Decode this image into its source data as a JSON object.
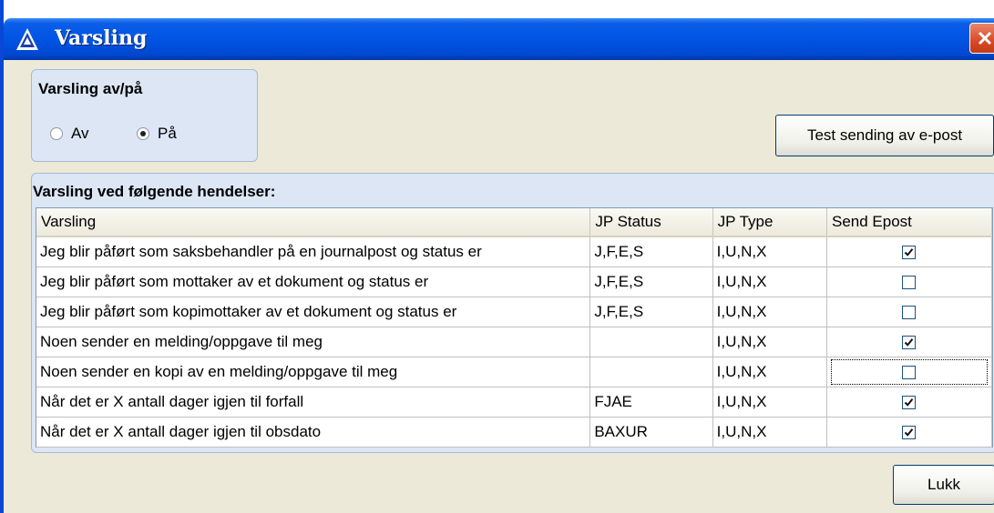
{
  "window": {
    "title": "Varsling",
    "colors": {
      "titlebar": "#0054e3",
      "close": "#d84a24",
      "groupbox": "#dce6f5",
      "face": "#ece9d8"
    }
  },
  "toggle_group": {
    "title": "Varsling av/på",
    "options": [
      {
        "label": "Av",
        "selected": false
      },
      {
        "label": "På",
        "selected": true
      }
    ]
  },
  "test_button": {
    "label": "Test sending av e-post"
  },
  "events_group": {
    "title": "Varsling ved følgende hendelser:",
    "columns": [
      "Varsling",
      "JP Status",
      "JP Type",
      "Send Epost"
    ],
    "rows": [
      {
        "varsling": "Jeg blir påført som saksbehandler på en journalpost og status er",
        "jp_status": "J,F,E,S",
        "jp_type": "I,U,N,X",
        "send_epost": true
      },
      {
        "varsling": "Jeg blir påført som mottaker av et dokument og status er",
        "jp_status": "J,F,E,S",
        "jp_type": "I,U,N,X",
        "send_epost": false
      },
      {
        "varsling": "Jeg blir påført som kopimottaker av et dokument og status er",
        "jp_status": "J,F,E,S",
        "jp_type": "I,U,N,X",
        "send_epost": false
      },
      {
        "varsling": "Noen sender en melding/oppgave til meg",
        "jp_status": "",
        "jp_type": "I,U,N,X",
        "send_epost": true
      },
      {
        "varsling": "Noen sender en kopi av en melding/oppgave til meg",
        "jp_status": "",
        "jp_type": "I,U,N,X",
        "send_epost": false,
        "focused": true
      },
      {
        "varsling": "Når det er X antall dager igjen til forfall",
        "jp_status": "FJAE",
        "jp_type": "I,U,N,X",
        "send_epost": true
      },
      {
        "varsling": "Når det er X antall dager igjen til obsdato",
        "jp_status": "BAXUR",
        "jp_type": "I,U,N,X",
        "send_epost": true
      }
    ]
  },
  "close_button": {
    "label": "Lukk"
  }
}
